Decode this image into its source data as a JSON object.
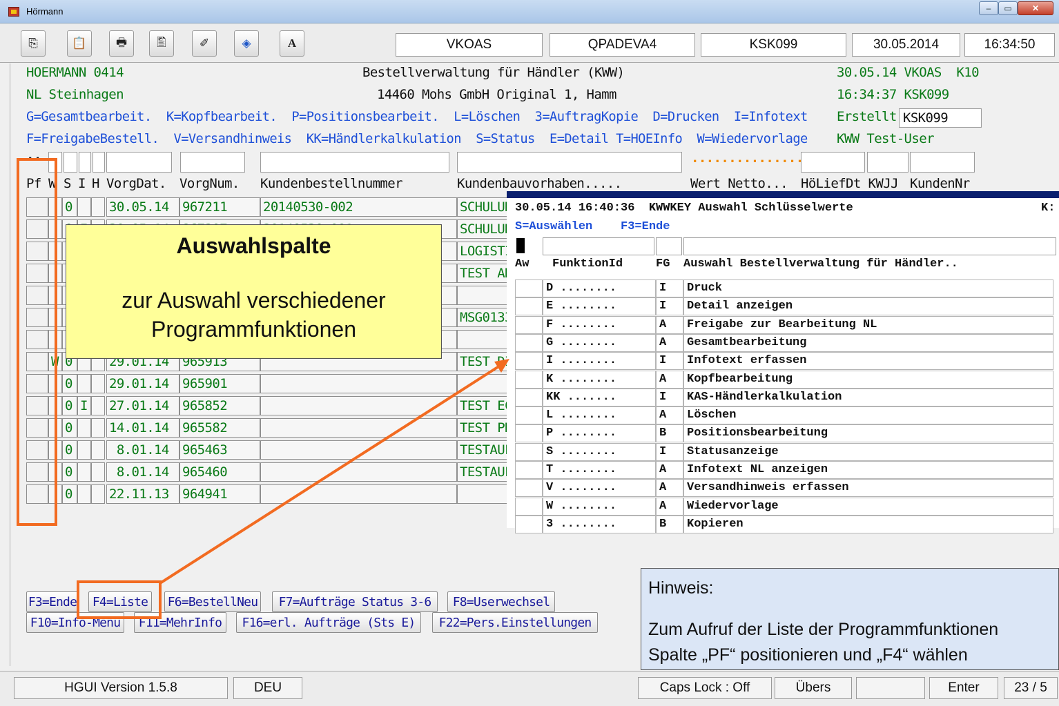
{
  "window": {
    "title": "Hörmann",
    "min": "–",
    "max": "▭",
    "close": "✕"
  },
  "toolbar": {
    "buttons": [
      {
        "icon": "copy-icon",
        "glyph": "⎘"
      },
      {
        "icon": "paste-icon",
        "glyph": "📋"
      },
      {
        "icon": "print-icon",
        "glyph": "🖶"
      },
      {
        "icon": "print-preview-icon",
        "glyph": "🖺"
      },
      {
        "icon": "eraser-icon",
        "glyph": "✐"
      },
      {
        "icon": "diamond-icon",
        "glyph": "◈"
      },
      {
        "icon": "font-icon",
        "glyph": "A"
      }
    ],
    "fields": [
      "VKOAS",
      "QPADEVA4",
      "KSK099",
      "30.05.2014",
      "16:34:50"
    ]
  },
  "header": {
    "company": "HOERMANN 0414",
    "title": "Bestellverwaltung für Händler (KWW)",
    "date_user": "30.05.14 VKOAS  K10",
    "branch": "NL Steinhagen",
    "customer": "14460 Mohs GmbH Original 1, Hamm",
    "time_user": "16:34:37 KSK099",
    "options_line1": "G=Gesamtbearbeit.  K=Kopfbearbeit.  P=Positionsbearbeit.  L=Löschen  3=AuftragKopie  D=Drucken  I=Infotext",
    "created_label": "Erstellt",
    "created_value": "KSK099",
    "options_line2": "F=FreigabeBestell.  V=Versandhinweis  KK=Händlerkalkulation  S=Status  E=Detail T=HOEInfo  W=Wiedervorlage",
    "test_user": "KWW Test-User",
    "filter_marker": "..",
    "dashes": "..............."
  },
  "table": {
    "columns": {
      "pf": "Pf",
      "w": "W",
      "s": "S",
      "i": "I",
      "h": "H",
      "vorgdat": "VorgDat.",
      "vorgnum": "VorgNum.",
      "kundenbestell": "Kundenbestellnummer",
      "kundenbau": "Kundenbauvorhaben.....",
      "wert": "Wert Netto...",
      "hoelief": "HöLiefDt KWJJ",
      "kundennr": "KundenNr"
    },
    "rows": [
      {
        "w": "",
        "s": "0",
        "i": "",
        "date": "30.05.14",
        "num": "967211",
        "kb": "20140530-002",
        "bau": "SCHULUN"
      },
      {
        "w": "",
        "s": "0",
        "i": "I",
        "date": "30.05.14",
        "num": "967207",
        "kb": "20140530-001",
        "bau": "SCHULUN"
      },
      {
        "w": "",
        "s": "",
        "i": "",
        "date": "",
        "num": "",
        "kb": "",
        "bau": "LOGISTI"
      },
      {
        "w": "",
        "s": "",
        "i": "",
        "date": "",
        "num": "",
        "kb": "",
        "bau": "TEST AN"
      },
      {
        "w": "",
        "s": "",
        "i": "",
        "date": "",
        "num": "",
        "kb": "",
        "bau": ""
      },
      {
        "w": "",
        "s": "",
        "i": "",
        "date": "",
        "num": "",
        "kb": "",
        "bau": "MSG0133"
      },
      {
        "w": "",
        "s": "",
        "i": "",
        "date": "",
        "num": "",
        "kb": "",
        "bau": ""
      },
      {
        "w": "W",
        "s": "0",
        "i": "",
        "date": "29.01.14",
        "num": "965913",
        "kb": "",
        "bau": "TEST DI"
      },
      {
        "w": "",
        "s": "0",
        "i": "",
        "date": "29.01.14",
        "num": "965901",
        "kb": "",
        "bau": ""
      },
      {
        "w": "",
        "s": "0",
        "i": "I",
        "date": "27.01.14",
        "num": "965852",
        "kb": "",
        "bau": "TEST EC"
      },
      {
        "w": "",
        "s": "0",
        "i": "",
        "date": "14.01.14",
        "num": "965582",
        "kb": "",
        "bau": "TEST PK"
      },
      {
        "w": "",
        "s": "0",
        "i": "",
        "date": " 8.01.14",
        "num": "965463",
        "kb": "",
        "bau": "TESTAUF"
      },
      {
        "w": "",
        "s": "0",
        "i": "",
        "date": " 8.01.14",
        "num": "965460",
        "kb": "",
        "bau": "TESTAUF"
      },
      {
        "w": "",
        "s": "0",
        "i": "",
        "date": "22.11.13",
        "num": "964941",
        "kb": "",
        "bau": ""
      }
    ]
  },
  "popup": {
    "header": "30.05.14 16:40:36  KWWKEY Auswahl Schlüsselwerte",
    "header_right": "K:",
    "options": "S=Auswählen    F3=Ende",
    "col_aw": "Aw",
    "col_funktion": "FunktionId",
    "col_fg": "FG",
    "col_auswahl": "Auswahl Bestellverwaltung für Händler..",
    "rows": [
      {
        "id": "D ........",
        "fg": "I",
        "text": "Druck"
      },
      {
        "id": "E ........",
        "fg": "I",
        "text": "Detail anzeigen"
      },
      {
        "id": "F ........",
        "fg": "A",
        "text": "Freigabe zur Bearbeitung NL"
      },
      {
        "id": "G ........",
        "fg": "A",
        "text": "Gesamtbearbeitung"
      },
      {
        "id": "I ........",
        "fg": "I",
        "text": "Infotext erfassen"
      },
      {
        "id": "K ........",
        "fg": "A",
        "text": "Kopfbearbeitung"
      },
      {
        "id": "KK .......",
        "fg": "I",
        "text": "KAS-Händlerkalkulation"
      },
      {
        "id": "L ........",
        "fg": "A",
        "text": "Löschen"
      },
      {
        "id": "P ........",
        "fg": "B",
        "text": "Positionsbearbeitung"
      },
      {
        "id": "S ........",
        "fg": "I",
        "text": "Statusanzeige"
      },
      {
        "id": "T ........",
        "fg": "A",
        "text": "Infotext NL anzeigen"
      },
      {
        "id": "V ........",
        "fg": "A",
        "text": "Versandhinweis erfassen"
      },
      {
        "id": "W ........",
        "fg": "A",
        "text": "Wiedervorlage"
      },
      {
        "id": "3 ........",
        "fg": "B",
        "text": "Kopieren"
      }
    ]
  },
  "callout": {
    "title": "Auswahlspalte",
    "body_line1": "zur Auswahl verschiedener",
    "body_line2": "Programmfunktionen"
  },
  "fkeys": {
    "row1": [
      "F3=Ende",
      "F4=Liste",
      "F6=BestellNeu",
      "F7=Aufträge Status 3-6",
      "F8=Userwechsel"
    ],
    "row2": [
      "F10=Info-Menü",
      "F11=MehrInfo",
      "F16=erl. Aufträge (Sts E)",
      "F22=Pers.Einstellungen"
    ]
  },
  "hint": {
    "title": "Hinweis:",
    "body": "Zum Aufruf der Liste der Programmfunktionen\nSpalte „PF“ positionieren und „F4“ wählen"
  },
  "status": {
    "version": "HGUI Version 1.5.8",
    "lang": "DEU",
    "caps": "Caps Lock : Off",
    "mode": "Übers",
    "empty": "",
    "enter": "Enter",
    "cursor": "23 / 5"
  },
  "colors": {
    "accent": "#f26b21",
    "terminal_green": "#0a7a17",
    "terminal_blue": "#1d4fd8",
    "popup_border": "#0a1f6e"
  }
}
